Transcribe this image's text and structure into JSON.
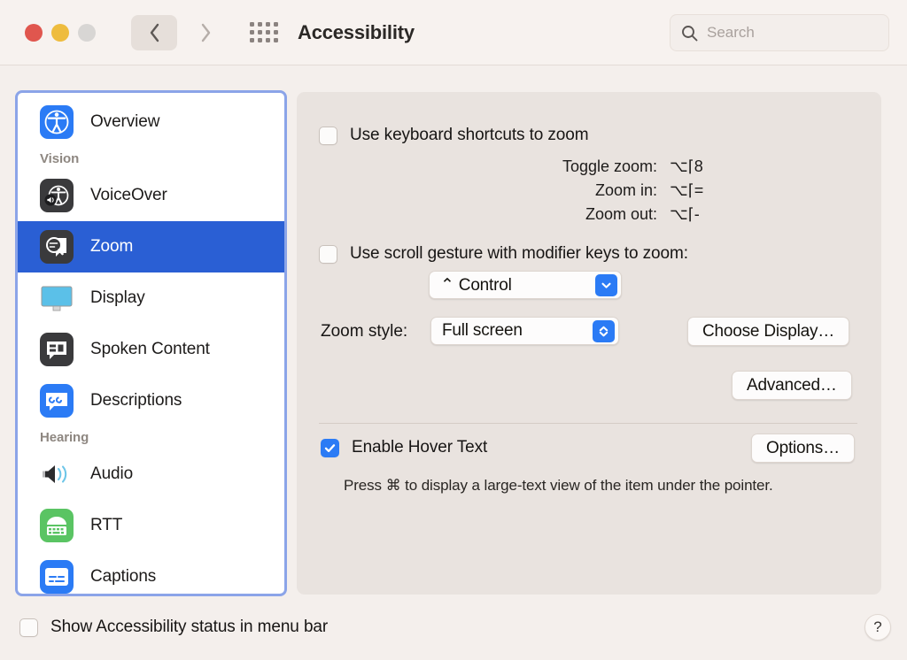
{
  "window": {
    "title": "Accessibility",
    "traffic_lights": [
      "close",
      "minimize",
      "zoom"
    ],
    "back_label": "Back",
    "forward_label": "Forward",
    "grid_label": "Show All"
  },
  "search": {
    "placeholder": "Search",
    "value": "",
    "icon": "search-icon"
  },
  "sidebar": {
    "items": [
      {
        "type": "item",
        "label": "Overview",
        "icon": "accessibility-icon",
        "selected": false
      },
      {
        "type": "header",
        "label": "Vision"
      },
      {
        "type": "item",
        "label": "VoiceOver",
        "icon": "voiceover-icon",
        "selected": false
      },
      {
        "type": "item",
        "label": "Zoom",
        "icon": "zoom-icon",
        "selected": true
      },
      {
        "type": "item",
        "label": "Display",
        "icon": "display-icon",
        "selected": false
      },
      {
        "type": "item",
        "label": "Spoken Content",
        "icon": "spoken-content-icon",
        "selected": false
      },
      {
        "type": "item",
        "label": "Descriptions",
        "icon": "descriptions-icon",
        "selected": false
      },
      {
        "type": "header",
        "label": "Hearing"
      },
      {
        "type": "item",
        "label": "Audio",
        "icon": "audio-icon",
        "selected": false
      },
      {
        "type": "item",
        "label": "RTT",
        "icon": "rtt-icon",
        "selected": false
      },
      {
        "type": "item",
        "label": "Captions",
        "icon": "captions-icon",
        "selected": false
      }
    ]
  },
  "panel": {
    "keyboard_shortcuts": {
      "label": "Use keyboard shortcuts to zoom",
      "checked": false,
      "rows": [
        {
          "name": "Toggle zoom:",
          "keys": "⌥⌈8"
        },
        {
          "name": "Zoom in:",
          "keys": "⌥⌈="
        },
        {
          "name": "Zoom out:",
          "keys": "⌥⌈-"
        }
      ]
    },
    "scroll_gesture": {
      "label": "Use scroll gesture with modifier keys to zoom:",
      "checked": false,
      "modifier_value": "⌃ Control",
      "modifier_icon": "chevron-down-icon"
    },
    "zoom_style": {
      "label": "Zoom style:",
      "value": "Full screen",
      "icon": "up-down-chevrons-icon"
    },
    "choose_display_button": "Choose Display…",
    "advanced_button": "Advanced…",
    "hover_text": {
      "label": "Enable Hover Text",
      "checked": true,
      "options_button": "Options…",
      "note": "Press ⌘ to display a large-text view of the item under the pointer."
    }
  },
  "bottom": {
    "status_checkbox": {
      "label": "Show Accessibility status in menu bar",
      "checked": false
    },
    "help_button": "?"
  },
  "colors": {
    "accent_blue": "#2b7bf5",
    "selection_blue": "#2a5fd4",
    "focus_ring": "#8ba4e8",
    "window_bg": "#f4efec",
    "panel_bg": "#e9e3df"
  }
}
